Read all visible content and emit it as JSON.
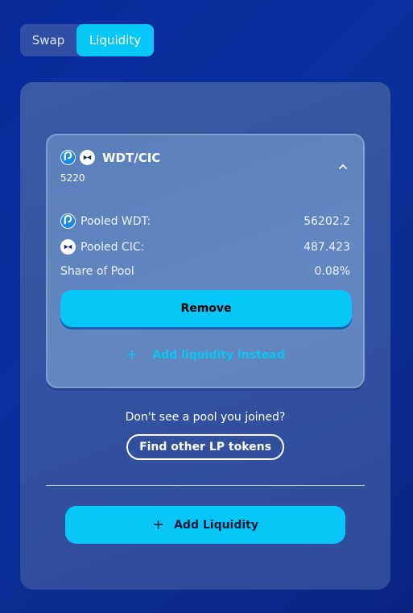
{
  "tabs": {
    "swap": "Swap",
    "liquidity": "Liquidity",
    "active": "liquidity"
  },
  "pool": {
    "token_a": "WDT",
    "token_b": "CIC",
    "pair": "WDT/CIC",
    "balance": "5220",
    "expanded": true,
    "rows": [
      {
        "label": "Pooled WDT:",
        "value": "56202.2",
        "icon": "wdt-token-icon"
      },
      {
        "label": "Pooled CIC:",
        "value": "487.423",
        "icon": "cic-token-icon"
      },
      {
        "label": "Share of Pool",
        "value": "0.08%"
      }
    ],
    "remove_label": "Remove",
    "add_instead_label": "Add liquidity instead"
  },
  "dont_see": "Don't see a pool you joined?",
  "find_label": "Find other LP tokens",
  "add_liquidity_label": "Add Liquidity",
  "colors": {
    "accent": "#07c6f8",
    "background": "#0a2a9a",
    "card": "#33529f",
    "pool_card": "#6387c0"
  }
}
